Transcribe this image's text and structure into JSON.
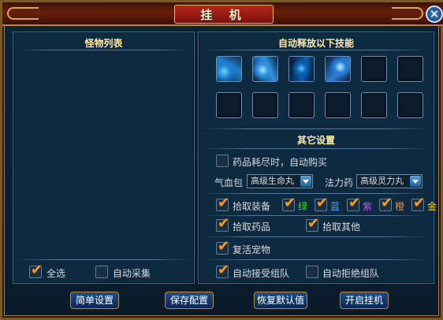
{
  "window": {
    "title": "挂 机",
    "close_label": "✕"
  },
  "left_panel": {
    "title": "怪物列表",
    "select_all": {
      "label": "全选",
      "checked": true
    },
    "auto_collect": {
      "label": "自动采集",
      "checked": false
    }
  },
  "right_panel": {
    "skills_title": "自动释放以下技能",
    "skills": [
      {
        "name": "skill-1",
        "filled": true
      },
      {
        "name": "skill-2",
        "filled": true
      },
      {
        "name": "skill-3",
        "filled": true
      },
      {
        "name": "skill-4",
        "filled": true
      },
      {
        "name": "empty",
        "filled": false
      },
      {
        "name": "empty",
        "filled": false
      },
      {
        "name": "empty",
        "filled": false
      },
      {
        "name": "empty",
        "filled": false
      },
      {
        "name": "empty",
        "filled": false
      },
      {
        "name": "empty",
        "filled": false
      },
      {
        "name": "empty",
        "filled": false
      },
      {
        "name": "empty",
        "filled": false
      }
    ],
    "other_title": "其它设置",
    "auto_buy": {
      "label": "药品耗尽时，自动购买",
      "checked": false
    },
    "hp_label": "气血包",
    "hp_value": "高级生命丸",
    "mp_label": "法力药",
    "mp_value": "高级灵力丸",
    "pick_equip": {
      "label": "拾取装备",
      "checked": true
    },
    "quality": [
      {
        "label": "绿",
        "checked": true,
        "color": "#3bd23b"
      },
      {
        "label": "蓝",
        "checked": true,
        "color": "#3fa7ff"
      },
      {
        "label": "紫",
        "checked": true,
        "color": "#c052ff"
      },
      {
        "label": "橙",
        "checked": true,
        "color": "#ff8a1e"
      },
      {
        "label": "金",
        "checked": true,
        "color": "#ffd21e"
      }
    ],
    "pick_potion": {
      "label": "拾取药品",
      "checked": true
    },
    "pick_other": {
      "label": "拾取其他",
      "checked": true
    },
    "revive_pet": {
      "label": "复活宠物",
      "checked": true
    },
    "auto_accept_team": {
      "label": "自动接受组队",
      "checked": true
    },
    "auto_reject_team": {
      "label": "自动拒绝组队",
      "checked": false
    }
  },
  "buttons": {
    "simple": "简单设置",
    "save": "保存配置",
    "restore": "恢复默认值",
    "start": "开启挂机"
  },
  "tick": "✔"
}
